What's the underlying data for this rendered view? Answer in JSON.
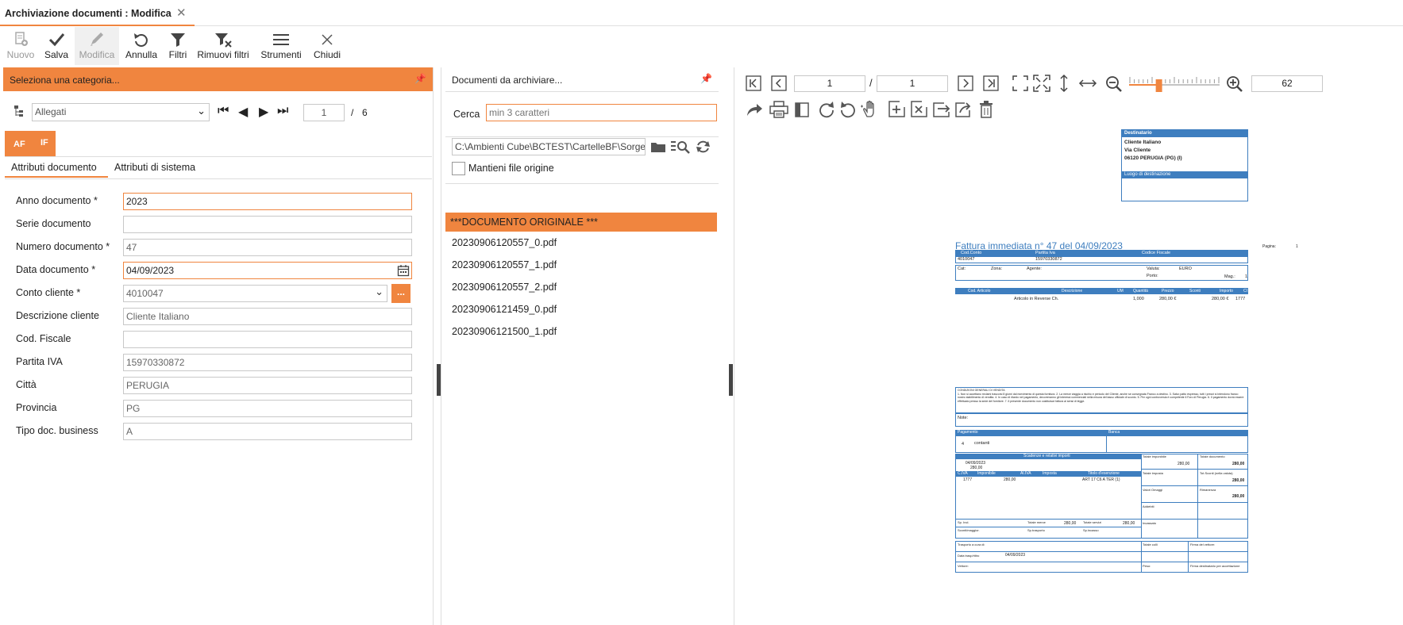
{
  "tab": {
    "title": "Archiviazione documenti : Modifica",
    "close": "✕"
  },
  "toolbar": [
    {
      "label": "Nuovo",
      "icon": "new-document-icon"
    },
    {
      "label": "Salva",
      "icon": "check-icon"
    },
    {
      "label": "Modifica",
      "icon": "pencil-icon"
    },
    {
      "label": "Annulla",
      "icon": "undo-icon"
    },
    {
      "label": "Filtri",
      "icon": "filter-icon"
    },
    {
      "label": "Rimuovi filtri",
      "icon": "filter-remove-icon"
    },
    {
      "label": "Strumenti",
      "icon": "menu-icon"
    },
    {
      "label": "Chiudi",
      "icon": "close-icon"
    }
  ],
  "left": {
    "header": "Seleziona una categoria...",
    "category": "Allegati",
    "record_current": "1",
    "record_sep": "/",
    "record_total": "6",
    "badges": [
      "AF",
      "IF"
    ],
    "tabs": [
      "Attributi documento",
      "Attributi di sistema"
    ],
    "fields": [
      {
        "label": "Anno documento *",
        "value": "2023"
      },
      {
        "label": "Serie documento",
        "value": ""
      },
      {
        "label": "Numero documento *",
        "value": "47"
      },
      {
        "label": "Data documento *",
        "value": "04/09/2023"
      },
      {
        "label": "Conto cliente *",
        "value": "4010047"
      },
      {
        "label": "Descrizione cliente",
        "value": "Cliente Italiano"
      },
      {
        "label": "Cod. Fiscale",
        "value": ""
      },
      {
        "label": "Partita IVA",
        "value": "15970330872"
      },
      {
        "label": "Città",
        "value": "PERUGIA"
      },
      {
        "label": "Provincia",
        "value": "PG"
      },
      {
        "label": "Tipo doc. business",
        "value": "A"
      }
    ],
    "ellipsis": "..."
  },
  "middle": {
    "header": "Documenti da archiviare...",
    "search_label": "Cerca",
    "search_placeholder": "min 3 caratteri",
    "path": "C:\\Ambienti Cube\\BCTEST\\CartelleBF\\Sorge",
    "keep_origin": "Mantieni file origine",
    "files": [
      "***DOCUMENTO ORIGINALE ***",
      "20230906120557_0.pdf",
      "20230906120557_1.pdf",
      "20230906120557_2.pdf",
      "20230906121459_0.pdf",
      "20230906121500_1.pdf"
    ]
  },
  "viewer": {
    "page_current": "1",
    "page_sep": "/",
    "page_total": "1",
    "zoom": "62",
    "zoom_level": 0.33,
    "doc": {
      "dest_title": "Destinatario",
      "dest_lines": [
        "Cliente Italiano",
        "Via Cliente",
        "06120 PERUGIA (PG) (I)"
      ],
      "dest_place": "Luogo di destinazione",
      "heading": "Fattura immediata n° 47 del 04/09/2023",
      "page_label": "Pagina:",
      "page_no": "1",
      "h_codconto": "Cod.Conto",
      "h_piva": "Partita Iva",
      "h_cf": "Codice Fiscale",
      "codconto": "4010047",
      "piva": "15970330872",
      "cat": "Cat:",
      "zona": "Zona:",
      "agente": "Agente:",
      "valuta": "Valuta:",
      "valuta_val": "EURO",
      "porto": "Porto:",
      "mag": "Mag.:",
      "mag_val": "1",
      "cols": [
        "Cod. Articolo",
        "Descrizione",
        "UM",
        "Quantità",
        "Prezzo",
        "Sconti",
        "Importo",
        "CI"
      ],
      "row": [
        "Articolo in Reverse Ch.",
        "1,000",
        "280,00 €",
        "280,00 €",
        "1777"
      ],
      "cond_title": "CONDIZIONI GENERALI DI VENDITA",
      "cond_text": "1. Non si accettano reclami trascorsi 8 giorni dal ricevimento di questa fornitura. 2. La merce viaggia a rischio e pericolo del Cliente, anche se consegnata Franco a destino. 3. Salvo patto espresso, tutti i prezzi si intendono franco nostro stabilimento di vendita. 4. In caso di ritardo nel pagamento, decorreranno gli interessi commerciali nella misura del tasso ufficiale di sconto. 5. Per ogni controversia è competente il Foro di Perugia. 6. Il pagamento dovrà essere effettuato presso la sede del fornitore. 7. Il presente documento non costituisce fattura ai sensi di legge.",
      "note": "Note:",
      "pag_label": "Pagamento",
      "banca_label": "Banca",
      "pag_code": "4",
      "pag_desc": "contanti",
      "scad_title": "Scadenze e relativi importi",
      "scad_date": "04/09/2023",
      "scad_amount": "280,00",
      "iva_cols": [
        "C.IVA",
        "Imponibile",
        "Al.IVA",
        "Imposta",
        "Titolo d'esenzione"
      ],
      "iva_row": [
        "1777",
        "280,00",
        "ART 17 C6 A TER (1)"
      ],
      "tot_imponibile": "Totale imponibile",
      "tot_imponibile_val": "280,00",
      "tot_documento": "Totale documento",
      "tot_documento_val": "280,00",
      "tot_imposta": "Totale imposta",
      "tot_sconti": "Tot.Sconti (nella valuta)",
      "tot_sconti_val": "280,00",
      "spese": "Valori Omaggi",
      "rimanenza": "Rimanenza",
      "rimanenza_val": "280,00",
      "addebiti": "Addebiti",
      "incassato": "Incassato",
      "sp_incl": "Sp. Incl.",
      "tot_merce": "Totale merce",
      "tot_merce_val": "280,00",
      "tot_servizi": "Totale servizi",
      "tot_servizi_val": "280,00",
      "sconti_magg": "Sconti/maggior.",
      "sp_trasporto": "Sp.trasporto",
      "sp_incasso": "Sp.incasso",
      "trasporto": "Trasporto a cura di:",
      "tot_colli": "Totale colli",
      "firma_vett": "Firma del vettore:",
      "data_trasp": "Data trasp/ritiro",
      "data_trasp_val": "04/09/2023",
      "vettore": "Vettore:",
      "peso": "Peso:",
      "firma_dest": "Firma destinatario per accettazione"
    }
  },
  "colors": {
    "accent": "#f0853f",
    "doc_blue": "#3e7ebf"
  }
}
